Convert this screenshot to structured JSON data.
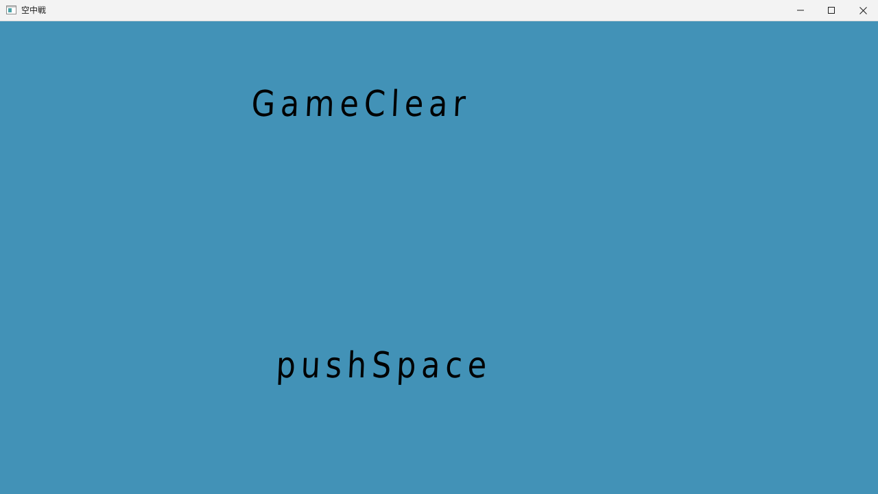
{
  "window": {
    "title": "空中戦",
    "icon": "app-window-icon",
    "controls": {
      "minimize_icon": "minimize-icon",
      "maximize_icon": "maximize-icon",
      "close_icon": "close-icon"
    }
  },
  "game": {
    "background_color": "#4292b7",
    "text_color": "#000000",
    "status_text": "GameClear",
    "prompt_text": "pushSpace"
  }
}
